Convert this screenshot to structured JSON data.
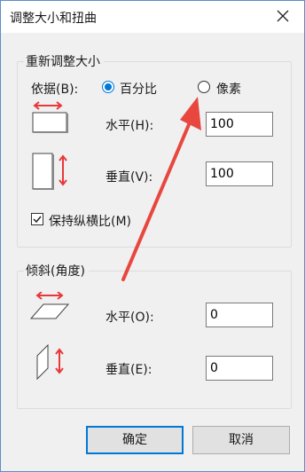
{
  "window": {
    "title": "调整大小和扭曲",
    "close_icon": "close-icon"
  },
  "resize": {
    "group_title": "重新调整大小",
    "basis_label": "依据(B):",
    "options": [
      {
        "label": "百分比",
        "selected": true
      },
      {
        "label": "像素",
        "selected": false
      }
    ],
    "horizontal_label": "水平(H):",
    "horizontal_value": "100",
    "vertical_label": "垂直(V):",
    "vertical_value": "100",
    "keep_ratio_label": "保持纵横比(M)",
    "keep_ratio_checked": true
  },
  "skew": {
    "group_title": "倾斜(角度)",
    "horizontal_label": "水平(O):",
    "horizontal_value": "0",
    "vertical_label": "垂直(E):",
    "vertical_value": "0"
  },
  "buttons": {
    "ok": "确定",
    "cancel": "取消"
  },
  "colors": {
    "accent": "#0078d7",
    "arrow_red": "#e8383a",
    "annotation_red": "#e8473f"
  }
}
